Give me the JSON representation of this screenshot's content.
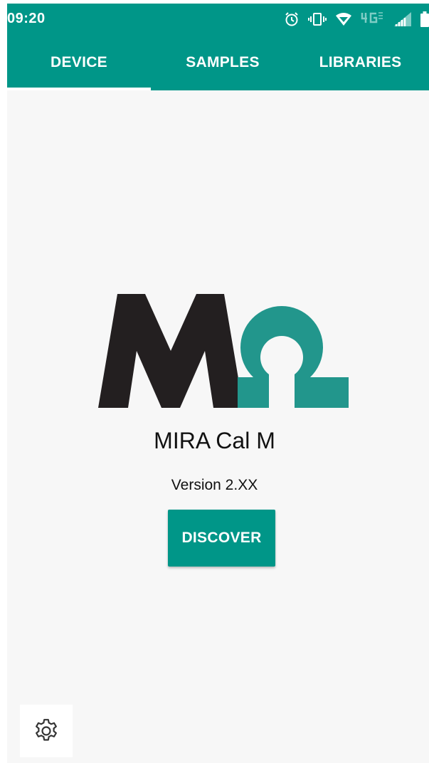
{
  "status_bar": {
    "time": "09:20",
    "icons": [
      "alarm-icon",
      "vibrate-icon",
      "wifi-icon",
      "4g-lte-icon",
      "signal-icon",
      "battery-icon"
    ]
  },
  "tabs": [
    {
      "label": "DEVICE",
      "selected": true
    },
    {
      "label": "SAMPLES",
      "selected": false
    },
    {
      "label": "LIBRARIES",
      "selected": false
    }
  ],
  "main": {
    "logo": "MIRA logo",
    "app_name": "MIRA Cal M",
    "version": "Version 2.XX",
    "discover_label": "DISCOVER"
  },
  "settings": {
    "icon": "gear-icon"
  },
  "colors": {
    "accent": "#009688",
    "logo_dark": "#231f20",
    "logo_teal": "#22968c",
    "background": "#f7f7f7"
  }
}
